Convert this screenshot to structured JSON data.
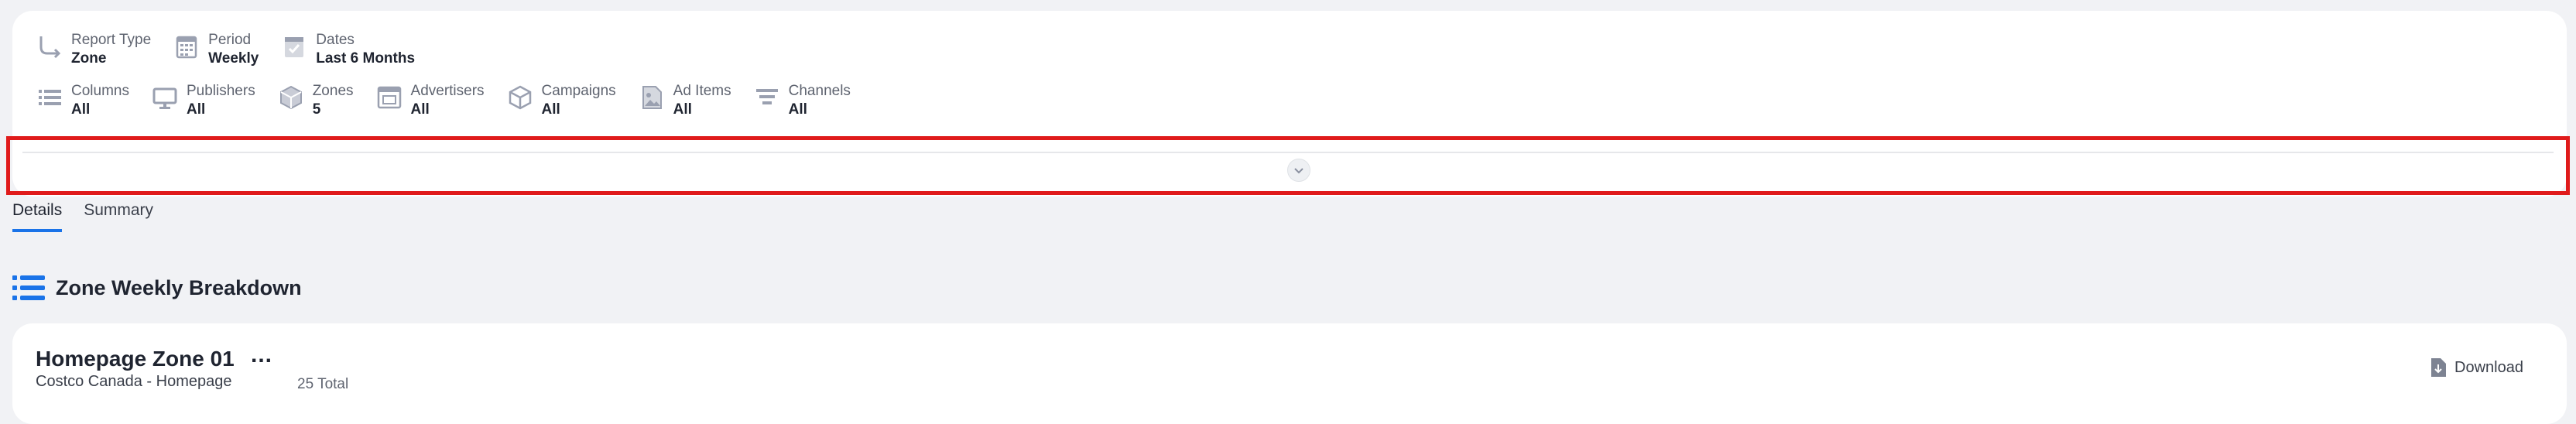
{
  "filters_row1": [
    {
      "label": "Report Type",
      "value": "Zone",
      "icon": "report-type-icon"
    },
    {
      "label": "Period",
      "value": "Weekly",
      "icon": "calendar-icon"
    },
    {
      "label": "Dates",
      "value": "Last 6 Months",
      "icon": "date-check-icon"
    }
  ],
  "filters_row2": [
    {
      "label": "Columns",
      "value": "All",
      "icon": "columns-icon"
    },
    {
      "label": "Publishers",
      "value": "All",
      "icon": "monitor-icon"
    },
    {
      "label": "Zones",
      "value": "5",
      "icon": "cube-icon"
    },
    {
      "label": "Advertisers",
      "value": "All",
      "icon": "advertiser-icon"
    },
    {
      "label": "Campaigns",
      "value": "All",
      "icon": "box-icon"
    },
    {
      "label": "Ad Items",
      "value": "All",
      "icon": "image-file-icon"
    },
    {
      "label": "Channels",
      "value": "All",
      "icon": "channels-icon"
    }
  ],
  "tabs": [
    {
      "label": "Details",
      "active": true
    },
    {
      "label": "Summary",
      "active": false
    }
  ],
  "section": {
    "title": "Zone Weekly Breakdown"
  },
  "zone_card": {
    "title": "Homepage Zone 01",
    "more": "...",
    "subtitle": "Costco Canada - Homepage",
    "total": "25 Total",
    "download_label": "Download"
  },
  "colors": {
    "accent": "#1a73e8",
    "highlight": "#e01b1b",
    "icon_gray": "#9aa0b0"
  }
}
